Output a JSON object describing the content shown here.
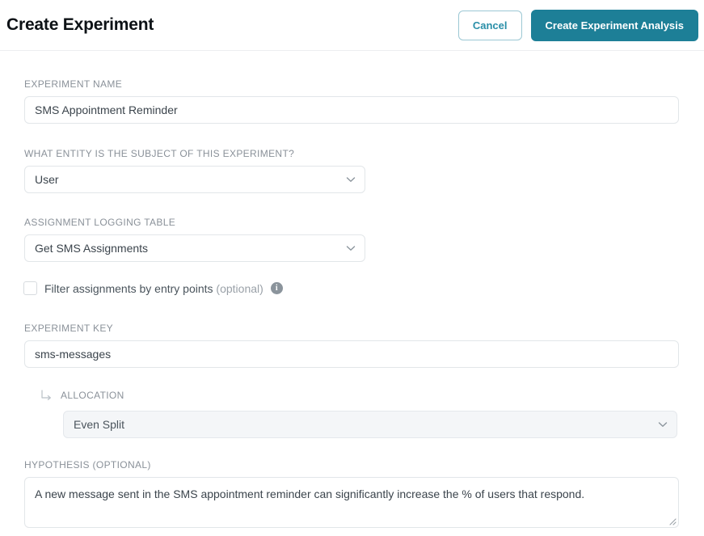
{
  "header": {
    "title": "Create Experiment",
    "cancel_label": "Cancel",
    "primary_label": "Create Experiment Analysis"
  },
  "theme": {
    "accent": "#1d7f97",
    "accent_text": "#2a8fa8",
    "label_gray": "#8a9199",
    "border_gray": "#e2e6e9",
    "muted_fill": "#f4f6f8",
    "title_color": "#0d1216"
  },
  "form": {
    "experiment_name": {
      "label": "EXPERIMENT NAME",
      "value": "SMS Appointment Reminder",
      "placeholder": "Experiment name"
    },
    "entity": {
      "label": "WHAT ENTITY IS THE SUBJECT OF THIS EXPERIMENT?",
      "value": "User"
    },
    "assignment_logging_table": {
      "label": "ASSIGNMENT LOGGING TABLE",
      "value": "Get SMS Assignments"
    },
    "filter_checkbox": {
      "label": "Filter assignments by entry points",
      "optional": "(optional)",
      "checked": false,
      "info_glyph": "i"
    },
    "experiment_key": {
      "label": "EXPERIMENT KEY",
      "value": "sms-messages",
      "placeholder": "Experiment key"
    },
    "allocation": {
      "label": "ALLOCATION",
      "value": "Even Split"
    },
    "hypothesis": {
      "label": "HYPOTHESIS (OPTIONAL)",
      "value": "A new message sent in the SMS appointment reminder can significantly increase the % of users that respond.",
      "placeholder": "Enter a hypothesis"
    }
  }
}
